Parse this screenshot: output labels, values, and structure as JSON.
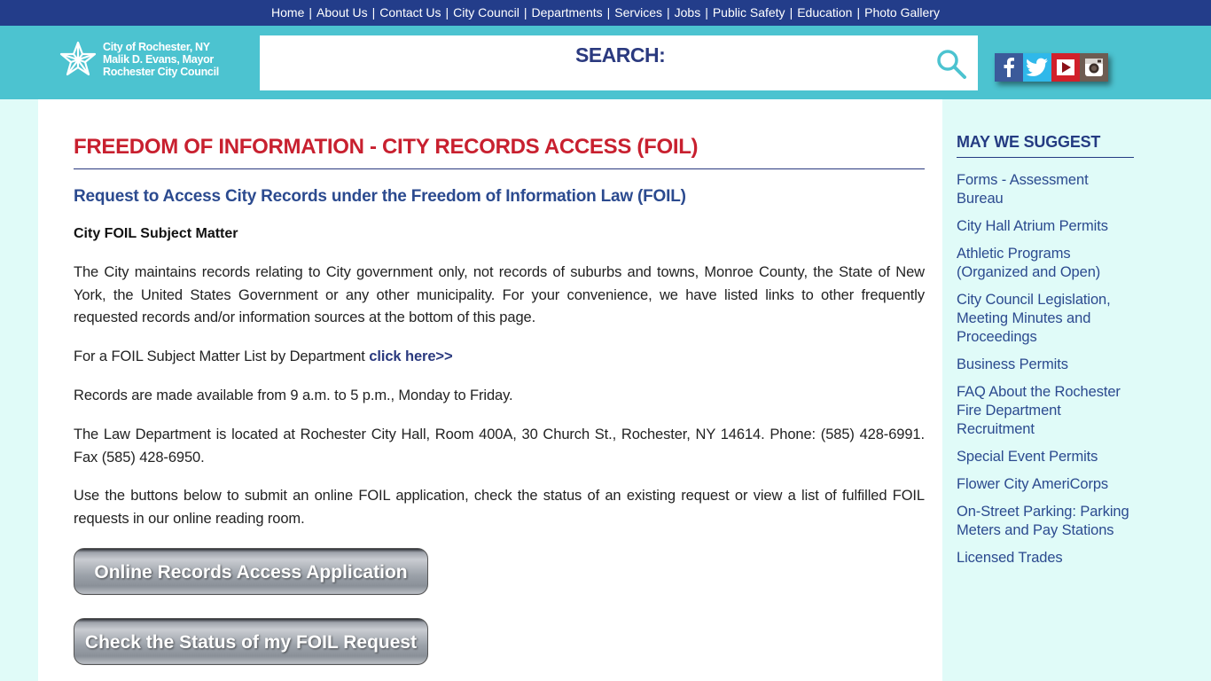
{
  "topnav": {
    "items": [
      "Home",
      "About Us",
      "Contact Us",
      "City Council",
      "Departments",
      "Services",
      "Jobs",
      "Public Safety",
      "Education",
      "Photo Gallery"
    ],
    "separator": "|"
  },
  "header": {
    "logo_lines": [
      "City of Rochester, NY",
      "Malik D. Evans, Mayor",
      "Rochester City Council"
    ],
    "search_label": "SEARCH:",
    "search_value": "",
    "social": [
      "facebook",
      "twitter",
      "youtube",
      "instagram"
    ]
  },
  "main": {
    "title": "FREEDOM OF INFORMATION - CITY RECORDS ACCESS (FOIL)",
    "subtitle": "Request to Access City Records under the Freedom of Information Law (FOIL)",
    "subhead": "City FOIL Subject Matter",
    "para1": "The City maintains records relating to City government only, not records of suburbs and towns, Monroe County, the State of New York, the United States Government or any other municipality. For your convenience, we have listed links to other frequently requested records and/or information sources at the bottom of this page.",
    "para2_text": "For a FOIL Subject Matter List by Department ",
    "para2_link": "click here>>",
    "para3": "Records are made available from 9 a.m. to 5 p.m., Monday to Friday.",
    "para4": "The Law Department is located at Rochester City Hall, Room 400A, 30 Church St., Rochester, NY 14614.  Phone: (585) 428-6991. Fax (585) 428-6950.",
    "para5": "Use the buttons below to submit an online FOIL application, check the status of an existing request or view a list of fulfilled FOIL requests in our online reading room.",
    "button1": "Online Records Access Application",
    "button2": "Check the Status of my FOIL Request"
  },
  "sidebar": {
    "title": "MAY WE SUGGEST",
    "links": [
      "Forms - Assessment Bureau",
      "City Hall Atrium Permits",
      "Athletic Programs (Organized and Open)",
      "City Council Legislation, Meeting Minutes and Proceedings",
      "Business Permits",
      "FAQ About the Rochester Fire Department Recruitment",
      "Special Event Permits",
      "Flower City AmeriCorps",
      "On-Street Parking: Parking Meters and Pay Stations",
      "Licensed Trades"
    ]
  },
  "colors": {
    "nav_bg": "#233d8a",
    "header_bg": "#4cc3d0",
    "title_red": "#c8202f",
    "link_blue": "#2b4a8f",
    "page_bg": "#e0fbf8"
  }
}
